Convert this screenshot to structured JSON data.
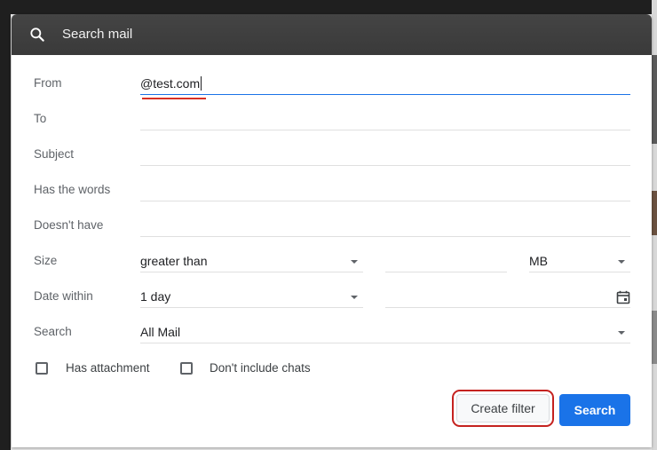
{
  "header": {
    "title": "Search mail",
    "icon": "search-icon"
  },
  "form": {
    "from": {
      "label": "From",
      "value": "@test.com"
    },
    "to": {
      "label": "To",
      "value": ""
    },
    "subject": {
      "label": "Subject",
      "value": ""
    },
    "has_words": {
      "label": "Has the words",
      "value": ""
    },
    "doesnt_have": {
      "label": "Doesn't have",
      "value": ""
    },
    "size": {
      "label": "Size",
      "operator": "greater than",
      "amount": "",
      "unit": "MB"
    },
    "date_within": {
      "label": "Date within",
      "range": "1 day",
      "date": ""
    },
    "search": {
      "label": "Search",
      "scope": "All Mail"
    }
  },
  "options": {
    "has_attachment": "Has attachment",
    "dont_include_chats": "Don't include chats"
  },
  "buttons": {
    "create_filter": "Create filter",
    "search": "Search"
  },
  "colors": {
    "accent": "#1a73e8",
    "highlight": "#d93025",
    "header_bg": "#3c3c3c"
  }
}
